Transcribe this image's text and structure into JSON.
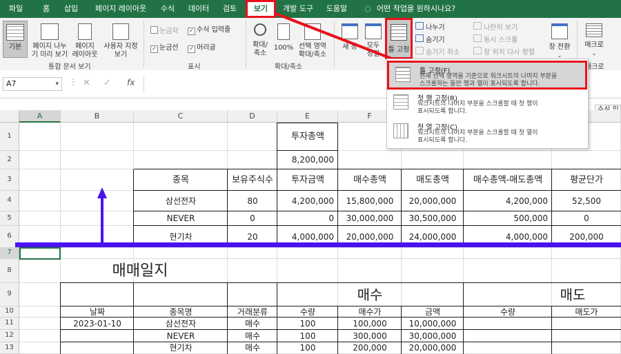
{
  "menu": [
    "파일",
    "홈",
    "삽입",
    "페이지 레이아웃",
    "수식",
    "데이터",
    "검토",
    "보기",
    "개발 도구",
    "도움말"
  ],
  "menu_active_index": 7,
  "tell_me": "어떤 작업을 원하시나요?",
  "ribbon": {
    "workbook_views": {
      "normal": "기본",
      "page_break": "페이지 나누\n기 미리 보기",
      "page_layout": "페이지\n레이아웃",
      "custom": "사용자 지정\n보기",
      "label": "통합 문서 보기"
    },
    "show": {
      "ruler": "눈금자",
      "formula_bar": "수식 입력줄",
      "gridlines": "눈금선",
      "headings": "머리글",
      "label": "표시"
    },
    "zoom": {
      "zoom": "확대/\n축소",
      "hundred": "100%",
      "selection": "선택 영역\n확대/축소",
      "label": "확대/축소"
    },
    "window": {
      "new": "새 창",
      "arrange": "모두\n정렬",
      "freeze": "틀 고정",
      "split": "나누기",
      "hide": "숨기기",
      "unhide": "숨기기 취소",
      "side_by_side": "나란히 보기",
      "sync_scroll": "동시 스크롤",
      "reset_pos": "창 위치 다시 정렬",
      "switch": "창 전환"
    },
    "macros": {
      "macro": "매크로",
      "label": "매크로"
    }
  },
  "name_box": "A7",
  "fx": "fx",
  "formula_tooltip": "수식 입",
  "dropdown": [
    {
      "title": "틀 고정(F)",
      "desc": [
        "현재 선택 영역을 기준으로 워크시트의 나머지 부분을",
        "스크롤하는 동안 행과 열이 표시되도록 합니다."
      ]
    },
    {
      "title": "첫 행 고정(R)",
      "desc": [
        "워크시트의 나머지 부분을 스크롤할 때 첫 행이",
        "표시되도록 합니다."
      ]
    },
    {
      "title": "첫 열 고정(C)",
      "desc": [
        "워크시트의 나머지 부분을 스크롤할 때 첫 열이",
        "표시되도록 합니다."
      ]
    }
  ],
  "columns": [
    "A",
    "B",
    "C",
    "D",
    "E",
    "F",
    "G",
    "H",
    "I"
  ],
  "rows": [
    "1",
    "2",
    "3",
    "4",
    "5",
    "6",
    "7",
    "8",
    "9",
    "10",
    "11",
    "12",
    "13"
  ],
  "sheet": {
    "invest_label": "투자총액",
    "invest_value": "8,200,000",
    "headers": [
      "종목",
      "보유주식수",
      "투자금액",
      "매수총액",
      "매도총액",
      "매수총액-매도총액",
      "평균단가"
    ],
    "rows": [
      [
        "삼선전자",
        "80",
        "4,200,000",
        "15,800,000",
        "20,000,000",
        "4,200,000",
        "52,500"
      ],
      [
        "NEVER",
        "0",
        "0",
        "30,000,000",
        "30,500,000",
        "500,000",
        "0"
      ],
      [
        "현기차",
        "20",
        "4,000,000",
        "20,000,000",
        "24,000,000",
        "4,000,000",
        "200,000"
      ]
    ],
    "journal_title": "매매일지",
    "buy_label": "매수",
    "sell_label": "매도",
    "journal_headers": [
      "날짜",
      "종목명",
      "거래분류",
      "수량",
      "매수가",
      "금액",
      "수량",
      "매도가"
    ],
    "journal_rows": [
      [
        "2023-01-10",
        "삼선전자",
        "매수",
        "100",
        "100,000",
        "10,000,000"
      ],
      [
        "",
        "NEVER",
        "매수",
        "100",
        "300,000",
        "30,000,000"
      ],
      [
        "",
        "현기차",
        "매수",
        "100",
        "200,000",
        "20,000,000"
      ]
    ]
  },
  "colors": {
    "excel_green": "#217346",
    "highlight_red": "#e8101a",
    "freeze_line": "#4a12f0"
  }
}
